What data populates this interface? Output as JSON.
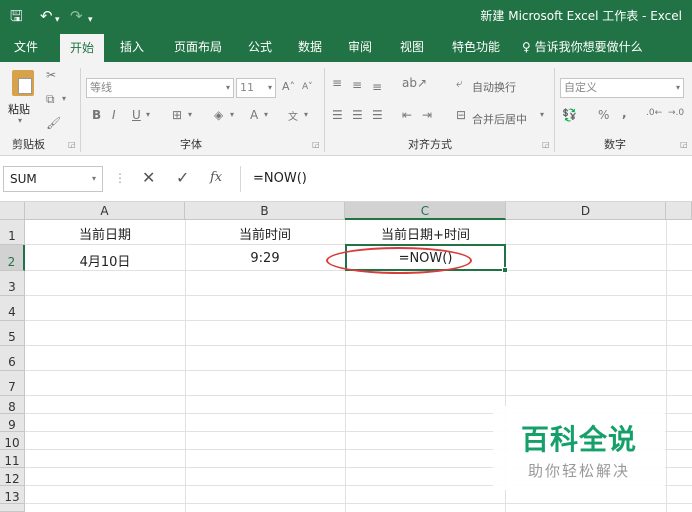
{
  "titlebar": {
    "save_icon": "save-icon",
    "undo_icon": "undo-icon",
    "redo_icon": "redo-icon",
    "window_title": "新建 Microsoft Excel 工作表 - Excel",
    "bg_color": "#217346"
  },
  "tabs": [
    "文件",
    "开始",
    "插入",
    "页面布局",
    "公式",
    "数据",
    "审阅",
    "视图",
    "特色功能",
    "告诉我你想要做什么"
  ],
  "active_tab": "开始",
  "ribbon": {
    "clipboard": {
      "paste_label": "粘贴",
      "group_label": "剪贴板"
    },
    "font": {
      "font_name": "等线",
      "font_size": "11",
      "bold": "B",
      "italic": "I",
      "underline": "U",
      "group_label": "字体"
    },
    "alignment": {
      "wrap_text": "自动换行",
      "merge_center": "合并后居中",
      "group_label": "对齐方式"
    },
    "number": {
      "format": "自定义",
      "percent": "%",
      "comma": ",",
      "group_label": "数字"
    }
  },
  "formula_bar": {
    "name_box": "SUM",
    "cancel": "✕",
    "enter": "✓",
    "fx": "fx",
    "formula": "=NOW()"
  },
  "sheet": {
    "columns": [
      "A",
      "B",
      "C",
      "D"
    ],
    "rows": [
      "1",
      "2",
      "3",
      "4",
      "5",
      "6",
      "7",
      "8",
      "9",
      "10",
      "11",
      "12",
      "13"
    ],
    "cells": {
      "A1": "当前日期",
      "B1": "当前时间",
      "C1": "当前日期+时间",
      "A2": "4月10日",
      "B2": "9:29",
      "C2": "=NOW()"
    },
    "active_cell": "C2"
  },
  "watermark": {
    "title": "百科全说",
    "subtitle": "助你轻松解决"
  }
}
